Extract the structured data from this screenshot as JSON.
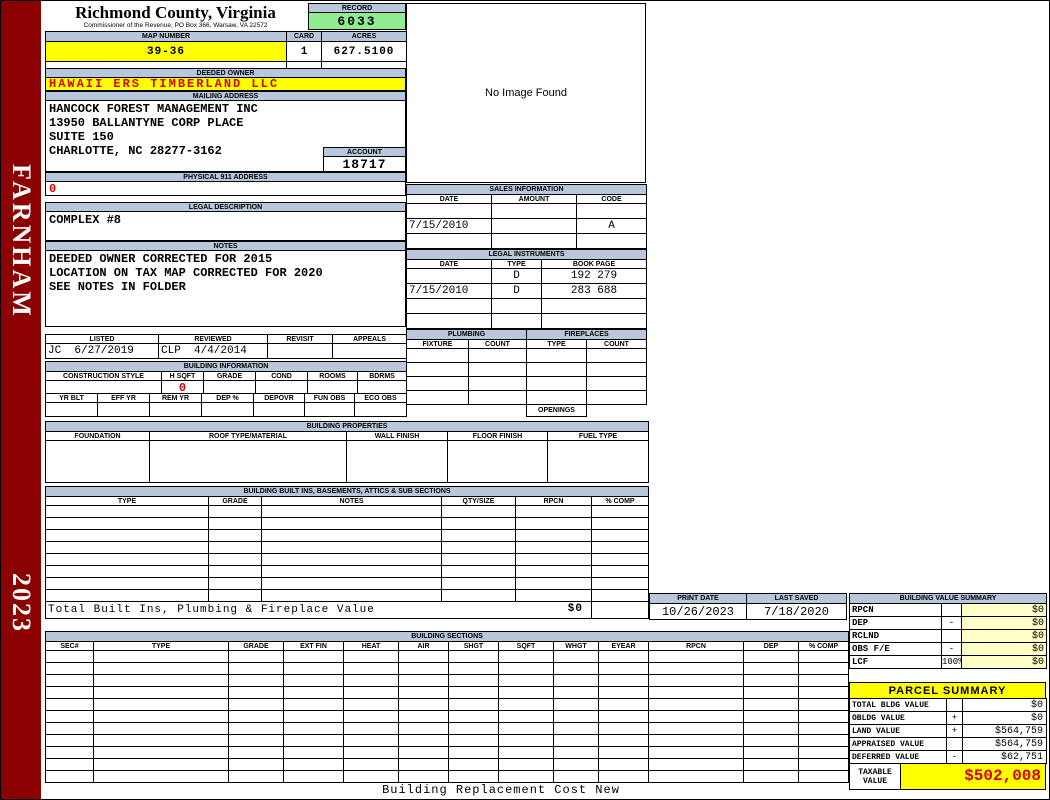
{
  "sidebar": {
    "district": "FARNHAM",
    "year": "2023"
  },
  "header": {
    "county": "Richmond County, Virginia",
    "office_line": "Commissioner of the Revenue, PO Box 366, Warsaw, VA 22572",
    "record_label": "RECORD",
    "record_value": "6033",
    "map_number_label": "MAP NUMBER",
    "map_number_value": "39-36",
    "card_label": "CARD",
    "card_value": "1",
    "acres_label": "ACRES",
    "acres_value": "627.5100"
  },
  "owner": {
    "deeded_owner_label": "DEEDED OWNER",
    "deeded_owner_value": "HAWAII ERS TIMBERLAND LLC",
    "mailing_address_label": "MAILING ADDRESS",
    "mailing_lines": [
      "HANCOCK FOREST MANAGEMENT INC",
      "13950 BALLANTYNE CORP PLACE",
      "SUITE 150",
      "CHARLOTTE, NC 28277-3162"
    ],
    "account_label": "ACCOUNT",
    "account_value": "18717",
    "physical_address_label": "PHYSICAL 911 ADDRESS",
    "physical_address_value": "0",
    "legal_description_label": "LEGAL DESCRIPTION",
    "legal_description_value": "COMPLEX #8",
    "notes_label": "NOTES",
    "notes_lines": [
      "DEEDED OWNER CORRECTED FOR 2015",
      "LOCATION ON TAX MAP CORRECTED FOR 2020",
      "SEE NOTES IN FOLDER"
    ]
  },
  "image_box": {
    "placeholder": "No Image Found"
  },
  "sales": {
    "title": "SALES INFORMATION",
    "columns": [
      "DATE",
      "AMOUNT",
      "CODE"
    ],
    "rows": [
      [
        "",
        "",
        ""
      ],
      [
        "7/15/2010",
        "",
        "A"
      ],
      [
        "",
        "",
        ""
      ]
    ]
  },
  "legal_instruments": {
    "title": "LEGAL INSTRUMENTS",
    "columns": [
      "DATE",
      "TYPE",
      "BOOK PAGE"
    ],
    "rows": [
      [
        "",
        "D",
        "192 279"
      ],
      [
        "7/15/2010",
        "D",
        "283 688"
      ],
      [
        "",
        "",
        ""
      ],
      [
        "",
        "",
        ""
      ]
    ]
  },
  "review": {
    "columns": [
      "LISTED",
      "REVIEWED",
      "REVISIT",
      "APPEALS"
    ],
    "rows": [
      [
        "JC  6/27/2019",
        "CLP  4/4/2014",
        "",
        ""
      ]
    ]
  },
  "building_info": {
    "title": "BUILDING INFORMATION",
    "columns_top": [
      "CONSTRUCTION STYLE",
      "H SQFT",
      "GRADE",
      "COND",
      "ROOMS",
      "BDRMS"
    ],
    "h_sqft_value": "0",
    "columns_bottom": [
      "YR BLT",
      "EFF YR",
      "REM YR",
      "DEP %",
      "DEPOVR",
      "FUN OBS",
      "ECO OBS"
    ],
    "empty_row_count": 1
  },
  "plumbing_fireplaces": {
    "plumbing_title": "PLUMBING",
    "fireplaces_title": "FIREPLACES",
    "columns": [
      "FIXTURE",
      "COUNT",
      "TYPE",
      "COUNT"
    ],
    "empty_row_count": 4,
    "openings_label": "OPENINGS"
  },
  "building_properties": {
    "title": "BUILDING PROPERTIES",
    "columns": [
      "FOUNDATION",
      "ROOF TYPE/MATERIAL",
      "WALL FINISH",
      "FLOOR FINISH",
      "FUEL TYPE"
    ],
    "empty_row_count": 1
  },
  "built_ins": {
    "title": "BUILDING BUILT INS, BASEMENTS, ATTICS & SUB SECTIONS",
    "columns": [
      "TYPE",
      "GRADE",
      "NOTES",
      "QTY/SIZE",
      "RPCN",
      "% COMP"
    ],
    "empty_row_count": 8,
    "total_label": "Total Built Ins, Plumbing & Fireplace Value",
    "total_value": "$0"
  },
  "print_info": {
    "print_date_label": "PRINT DATE",
    "print_date": "10/26/2023",
    "last_saved_label": "LAST SAVED",
    "last_saved": "7/18/2020"
  },
  "building_value_summary": {
    "title": "BUILDING VALUE SUMMARY",
    "rows": [
      [
        "RPCN",
        "",
        "$0"
      ],
      [
        "DEP",
        "-",
        "$0"
      ],
      [
        "RCLND",
        "",
        "$0"
      ],
      [
        "OBS F/E",
        "-",
        "$0"
      ],
      [
        "LCF",
        "100%",
        "$0"
      ]
    ]
  },
  "building_sections": {
    "title": "BUILDING SECTIONS",
    "columns": [
      "SEC#",
      "TYPE",
      "GRADE",
      "EXT FIN",
      "HEAT",
      "AIR",
      "SHGT",
      "SQFT",
      "WHGT",
      "EYEAR",
      "RPCN",
      "DEP",
      "% COMP"
    ],
    "empty_row_count": 11
  },
  "parcel_summary": {
    "title": "PARCEL SUMMARY",
    "rows": [
      [
        "TOTAL BLDG VALUE",
        "",
        "$0"
      ],
      [
        "OBLDG VALUE",
        "+",
        "$0"
      ],
      [
        "LAND VALUE",
        "+",
        "$564,759"
      ],
      [
        "APPRAISED VALUE",
        "",
        "$564,759"
      ],
      [
        "DEFERRED VALUE",
        "-",
        "$62,751"
      ]
    ],
    "taxable_label": "TAXABLE VALUE",
    "taxable_value": "$502,008"
  },
  "footer": {
    "note": "Building Replacement Cost New"
  },
  "colors": {
    "sidebar_maroon": "#8B0000",
    "section_header_blue": "#B8C7DB",
    "highlight_yellow": "#FFFF00",
    "record_green": "#90EE90",
    "accent_red": "#D40000",
    "value_cell_yellow": "#FFFFC8"
  }
}
